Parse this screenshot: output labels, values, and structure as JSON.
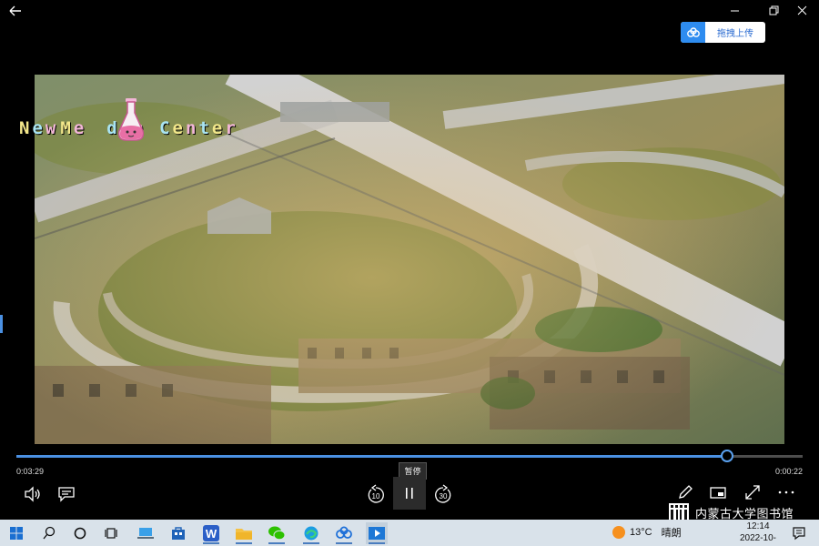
{
  "window": {
    "back_icon": "back-arrow-icon",
    "controls": [
      "minimize-icon",
      "maximize-icon",
      "close-icon"
    ]
  },
  "upload": {
    "label": "拖拽上传",
    "icon": "cloud-icon",
    "color": "#2e8cf0"
  },
  "watermark": {
    "chars": [
      "N",
      "e",
      "w",
      " ",
      "M",
      "e",
      "",
      "d",
      "i",
      "a",
      " ",
      "C",
      "e",
      "n",
      "t",
      "e",
      "r"
    ],
    "colors": [
      "#f3e78a",
      "#a9e4f2",
      "#f2b6d7",
      "#ffffff",
      "#f3e78a",
      "#f2b6d7",
      "#ffffff",
      "#a9e4f2",
      "#f3e78a",
      "#f2b6d7",
      "#ffffff",
      "#a9e4f2",
      "#f3e78a",
      "#f2b6d7",
      "#a9e4f2",
      "#f3e78a",
      "#f2b6d7"
    ],
    "icon": "flask-icon"
  },
  "player": {
    "elapsed": "0:03:29",
    "remaining": "0:00:22",
    "progress": 0.904,
    "tooltip": "暂停",
    "skip_back": "10",
    "skip_forward": "30",
    "accent": "#4a90e2"
  },
  "library": {
    "name": "内蒙古大学图书馆",
    "icon": "library-logo-icon"
  },
  "taskbar": {
    "temperature": "13°C",
    "condition": "晴朗",
    "time": "12:14",
    "date": "2022-10-24"
  }
}
